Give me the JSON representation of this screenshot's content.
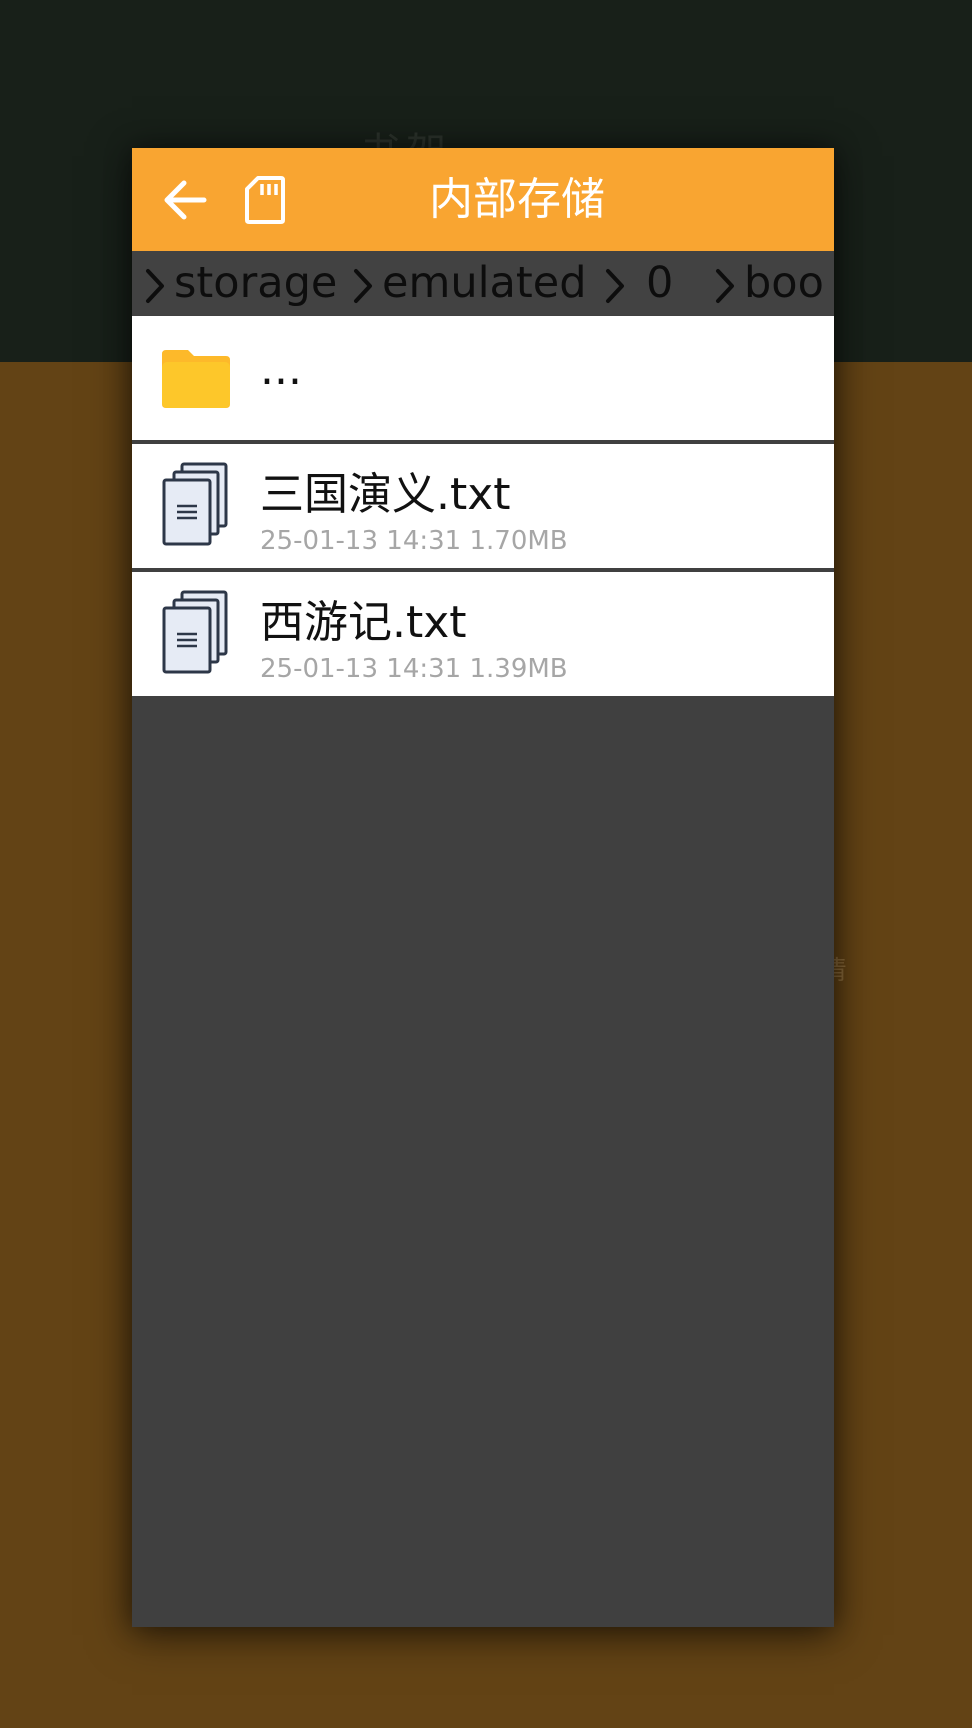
{
  "background": {
    "glyph_top": "书架",
    "glyph_right": "情"
  },
  "dialog": {
    "title": "内部存储",
    "back_icon": "arrow-left-icon",
    "storage_icon": "sd-card-icon",
    "breadcrumb": [
      "storage",
      "emulated",
      "0",
      "boo"
    ],
    "files": [
      {
        "name": "...",
        "type": "folder",
        "icon": "folder-icon",
        "meta": ""
      },
      {
        "name": "三国演义.txt",
        "type": "file",
        "icon": "text-document-icon",
        "meta": "25-01-13 14:31  1.70MB"
      },
      {
        "name": "西游记.txt",
        "type": "file",
        "icon": "text-document-icon",
        "meta": "25-01-13 14:31  1.39MB"
      }
    ]
  },
  "colors": {
    "titlebar": "#f9a531",
    "dialog_bg": "#404040",
    "screen_top": "#182019",
    "screen_bottom": "#634315",
    "folder": "#fdc72a"
  }
}
